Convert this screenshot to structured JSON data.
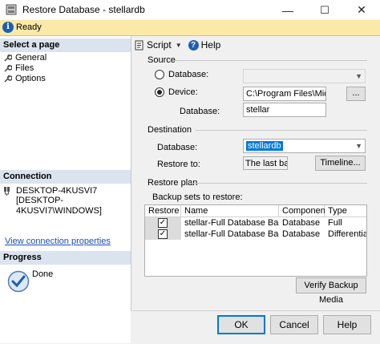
{
  "window": {
    "title": "Restore Database - stellardb",
    "minimize": "—",
    "maximize": "☐",
    "close": "✕"
  },
  "status": {
    "text": "Ready"
  },
  "left": {
    "select_page": "Select a page",
    "pages": [
      "General",
      "Files",
      "Options"
    ],
    "connection_head": "Connection",
    "connection_line1": "DESKTOP-4KUSVI7",
    "connection_line2": "[DESKTOP-4KUSVI7\\WINDOWS]",
    "view_conn_props": "View connection properties",
    "progress_head": "Progress",
    "progress_status": "Done"
  },
  "toolbar": {
    "script": "Script",
    "help": "Help"
  },
  "source": {
    "label": "Source",
    "database_radio": "Database:",
    "device_radio": "Device:",
    "device_value": "C:\\Program Files\\Microsof",
    "browse": "...",
    "database_label": "Database:",
    "database_value": "stellar"
  },
  "destination": {
    "label": "Destination",
    "database_label": "Database:",
    "database_value": "stellardb",
    "restore_to_label": "Restore to:",
    "restore_to_value": "The last back",
    "timeline_button": "Timeline..."
  },
  "restore_plan": {
    "label": "Restore plan",
    "backup_sets_label": "Backup sets to restore:",
    "columns": [
      "Restore",
      "Name",
      "Component",
      "Type"
    ],
    "rows": [
      {
        "restore": true,
        "name": "stellar-Full Database Backup",
        "component": "Database",
        "type": "Full"
      },
      {
        "restore": true,
        "name": "stellar-Full Database Backup",
        "component": "Database",
        "type": "Differential"
      }
    ],
    "verify_button": "Verify Backup Media"
  },
  "footer": {
    "ok": "OK",
    "cancel": "Cancel",
    "help": "Help"
  },
  "colors": {
    "status_bar": "#fbe9a8",
    "section_header": "#dbe3ee",
    "selection": "#0078d7",
    "link": "#1a4fb5"
  }
}
